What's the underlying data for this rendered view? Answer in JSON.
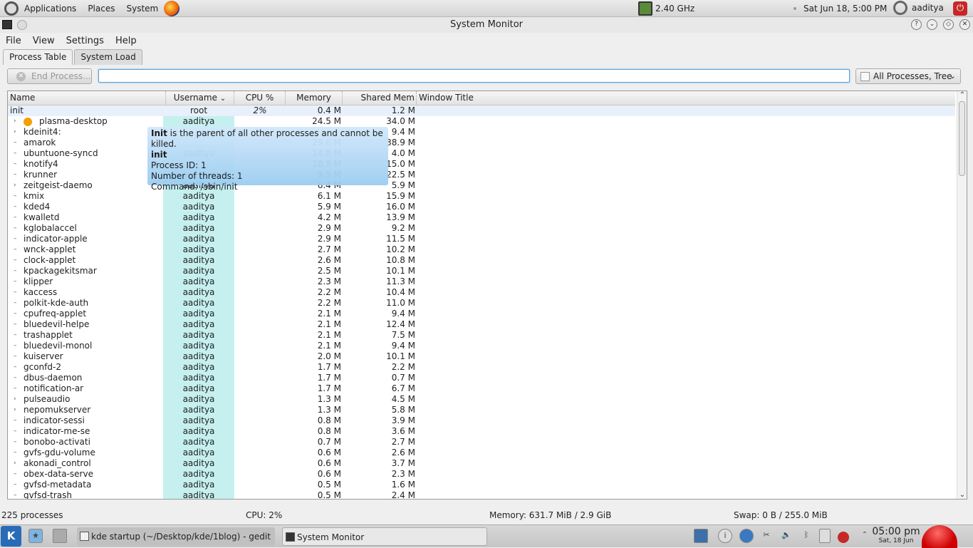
{
  "topbar": {
    "applications": "Applications",
    "places": "Places",
    "system": "System",
    "cpu_freq": "2.40 GHz",
    "datetime": "Sat Jun 18,  5:00 PM",
    "user": "aaditya"
  },
  "window": {
    "title": "System Monitor"
  },
  "menu": {
    "file": "File",
    "view": "View",
    "settings": "Settings",
    "help": "Help"
  },
  "tabs": [
    {
      "label": "Process Table"
    },
    {
      "label": "System Load"
    }
  ],
  "toolbar": {
    "end_process": "End Process...",
    "search_value": "",
    "filter": "All Processes, Tree"
  },
  "columns": {
    "name": "Name",
    "username": "Username",
    "cpu": "CPU %",
    "memory": "Memory",
    "shared": "Shared Mem",
    "window_title": "Window Title"
  },
  "processes": [
    {
      "name": "init",
      "user": "root",
      "cpu": "2%",
      "mem": "0.4 M",
      "shared": "1.2 M"
    },
    {
      "name": "plasma-desktop",
      "user": "aaditya",
      "cpu": "",
      "mem": "24.5 M",
      "shared": "34.0 M"
    },
    {
      "name": "kdeinit4:",
      "user": "",
      "cpu": "",
      "mem": "",
      "shared": "9.4 M"
    },
    {
      "name": "amarok",
      "user": "",
      "cpu": "",
      "mem": "29.6 M",
      "shared": "38.9 M"
    },
    {
      "name": "ubuntuone-syncd",
      "user": "aaditya",
      "cpu": "",
      "mem": "14.8 M",
      "shared": "4.0 M"
    },
    {
      "name": "knotify4",
      "user": "",
      "cpu": "",
      "mem": "10.9 M",
      "shared": "15.0 M"
    },
    {
      "name": "krunner",
      "user": "",
      "cpu": "",
      "mem": "9.5 M",
      "shared": "22.5 M"
    },
    {
      "name": "zeitgeist-daemo",
      "user": "aaditya",
      "cpu": "",
      "mem": "6.4 M",
      "shared": "5.9 M"
    },
    {
      "name": "kmix",
      "user": "aaditya",
      "cpu": "",
      "mem": "6.1 M",
      "shared": "15.9 M"
    },
    {
      "name": "kded4",
      "user": "aaditya",
      "cpu": "",
      "mem": "5.9 M",
      "shared": "16.0 M"
    },
    {
      "name": "kwalletd",
      "user": "aaditya",
      "cpu": "",
      "mem": "4.2 M",
      "shared": "13.9 M"
    },
    {
      "name": "kglobalaccel",
      "user": "aaditya",
      "cpu": "",
      "mem": "2.9 M",
      "shared": "9.2 M"
    },
    {
      "name": "indicator-apple",
      "user": "aaditya",
      "cpu": "",
      "mem": "2.9 M",
      "shared": "11.5 M"
    },
    {
      "name": "wnck-applet",
      "user": "aaditya",
      "cpu": "",
      "mem": "2.7 M",
      "shared": "10.2 M"
    },
    {
      "name": "clock-applet",
      "user": "aaditya",
      "cpu": "",
      "mem": "2.6 M",
      "shared": "10.8 M"
    },
    {
      "name": "kpackagekitsmar",
      "user": "aaditya",
      "cpu": "",
      "mem": "2.5 M",
      "shared": "10.1 M"
    },
    {
      "name": "klipper",
      "user": "aaditya",
      "cpu": "",
      "mem": "2.3 M",
      "shared": "11.3 M"
    },
    {
      "name": "kaccess",
      "user": "aaditya",
      "cpu": "",
      "mem": "2.2 M",
      "shared": "10.4 M"
    },
    {
      "name": "polkit-kde-auth",
      "user": "aaditya",
      "cpu": "",
      "mem": "2.2 M",
      "shared": "11.0 M"
    },
    {
      "name": "cpufreq-applet",
      "user": "aaditya",
      "cpu": "",
      "mem": "2.1 M",
      "shared": "9.4 M"
    },
    {
      "name": "bluedevil-helpe",
      "user": "aaditya",
      "cpu": "",
      "mem": "2.1 M",
      "shared": "12.4 M"
    },
    {
      "name": "trashapplet",
      "user": "aaditya",
      "cpu": "",
      "mem": "2.1 M",
      "shared": "7.5 M"
    },
    {
      "name": "bluedevil-monol",
      "user": "aaditya",
      "cpu": "",
      "mem": "2.1 M",
      "shared": "9.4 M"
    },
    {
      "name": "kuiserver",
      "user": "aaditya",
      "cpu": "",
      "mem": "2.0 M",
      "shared": "10.1 M"
    },
    {
      "name": "gconfd-2",
      "user": "aaditya",
      "cpu": "",
      "mem": "1.7 M",
      "shared": "2.2 M"
    },
    {
      "name": "dbus-daemon",
      "user": "aaditya",
      "cpu": "",
      "mem": "1.7 M",
      "shared": "0.7 M"
    },
    {
      "name": "notification-ar",
      "user": "aaditya",
      "cpu": "",
      "mem": "1.7 M",
      "shared": "6.7 M"
    },
    {
      "name": "pulseaudio",
      "user": "aaditya",
      "cpu": "",
      "mem": "1.3 M",
      "shared": "4.5 M"
    },
    {
      "name": "nepomukserver",
      "user": "aaditya",
      "cpu": "",
      "mem": "1.3 M",
      "shared": "5.8 M"
    },
    {
      "name": "indicator-sessi",
      "user": "aaditya",
      "cpu": "",
      "mem": "0.8 M",
      "shared": "3.9 M"
    },
    {
      "name": "indicator-me-se",
      "user": "aaditya",
      "cpu": "",
      "mem": "0.8 M",
      "shared": "3.6 M"
    },
    {
      "name": "bonobo-activati",
      "user": "aaditya",
      "cpu": "",
      "mem": "0.7 M",
      "shared": "2.7 M"
    },
    {
      "name": "gvfs-gdu-volume",
      "user": "aaditya",
      "cpu": "",
      "mem": "0.6 M",
      "shared": "2.6 M"
    },
    {
      "name": "akonadi_control",
      "user": "aaditya",
      "cpu": "",
      "mem": "0.6 M",
      "shared": "3.7 M"
    },
    {
      "name": "obex-data-serve",
      "user": "aaditya",
      "cpu": "",
      "mem": "0.6 M",
      "shared": "2.3 M"
    },
    {
      "name": "gvfsd-metadata",
      "user": "aaditya",
      "cpu": "",
      "mem": "0.5 M",
      "shared": "1.6 M"
    },
    {
      "name": "gvfsd-trash",
      "user": "aaditya",
      "cpu": "",
      "mem": "0.5 M",
      "shared": "2.4 M"
    }
  ],
  "tooltip": {
    "bold": "Init",
    "desc": " is the parent of all other processes and cannot be killed.",
    "name": "init",
    "pid": "Process ID: 1",
    "threads": "Number of threads: 1",
    "command": "Command: /sbin/init"
  },
  "status": {
    "processes": "225 processes",
    "cpu": "CPU: 2%",
    "memory": "Memory: 631.7 MiB / 2.9 GiB",
    "swap": "Swap: 0 B / 255.0 MiB"
  },
  "taskbar": {
    "gedit": "kde startup (~/Desktop/kde/1blog) - gedit",
    "sysmon": "System Monitor",
    "time": "05:00 pm",
    "date": "Sat, 18 Jun"
  }
}
